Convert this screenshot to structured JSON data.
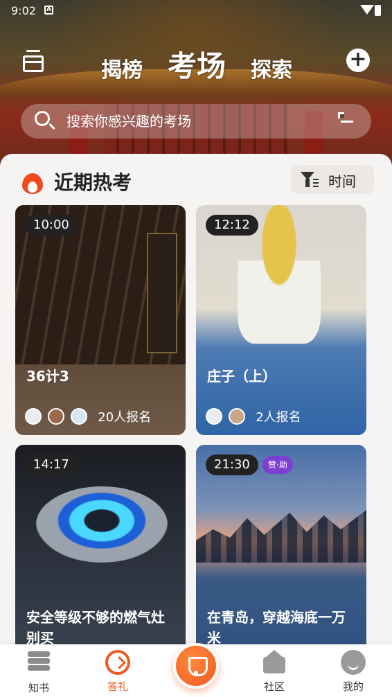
{
  "status_bar": {
    "time": "9:02",
    "notif_letter": "A"
  },
  "top_nav": {
    "tabs": [
      {
        "label": "揭榜"
      },
      {
        "label": "考场",
        "active": true
      },
      {
        "label": "探索"
      }
    ],
    "add_label": "+"
  },
  "search": {
    "placeholder": "搜索你感兴趣的考场"
  },
  "section": {
    "title": "近期热考",
    "sort_label": "时间"
  },
  "cards": [
    {
      "time": "10:00",
      "title": "36计3",
      "signup": "20人报名",
      "avatars": 3
    },
    {
      "time": "12:12",
      "title": "庄子（上）",
      "signup": "2人报名",
      "avatars": 2
    },
    {
      "time": "14:17",
      "title": "安全等级不够的燃气灶别买"
    },
    {
      "time": "21:30",
      "badge": "赞·助",
      "title": "在青岛，穿越海底一万米"
    }
  ],
  "bottom_nav": [
    {
      "label": "知书",
      "icon": "books-icon"
    },
    {
      "label": "答礼",
      "icon": "gift-icon",
      "active": true
    },
    {
      "label": "",
      "icon": "center-icon"
    },
    {
      "label": "社区",
      "icon": "community-icon"
    },
    {
      "label": "我的",
      "icon": "profile-icon"
    }
  ],
  "colors": {
    "accent": "#f05a20",
    "sponsor": "#7b3fd1"
  }
}
